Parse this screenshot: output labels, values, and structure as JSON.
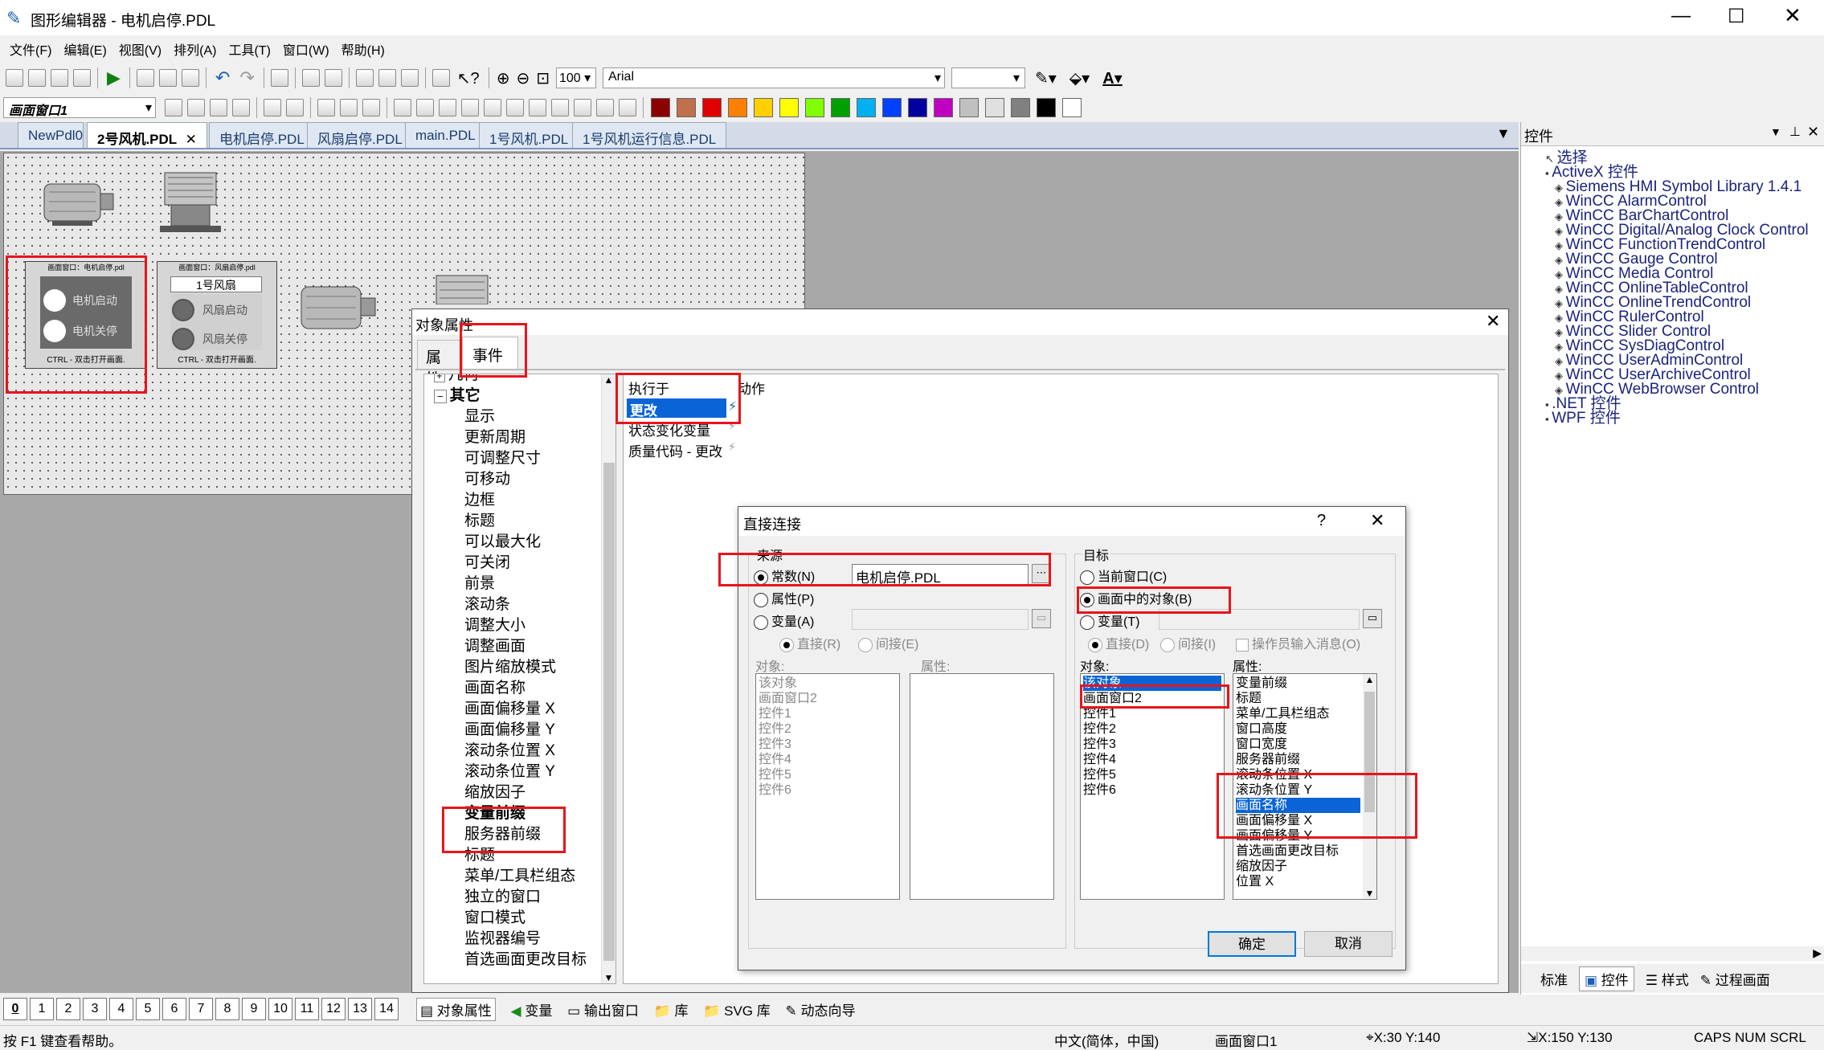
{
  "title_bar": {
    "title": "图形编辑器 - 电机启停.PDL"
  },
  "menu": [
    "文件(F)",
    "编辑(E)",
    "视图(V)",
    "排列(A)",
    "工具(T)",
    "窗口(W)",
    "帮助(H)"
  ],
  "toolbar": {
    "zoom": "100",
    "font": "Arial",
    "screen_window": "画面窗口1"
  },
  "palette_colors": [
    "#8b0000",
    "#c0704a",
    "#e00000",
    "#ff8000",
    "#ffd000",
    "#ffff00",
    "#80ff00",
    "#00a000",
    "#00b0f0",
    "#0040ff",
    "#0000a0",
    "#c000c0",
    "#c0c0c0",
    "#e0e0e0",
    "#808080",
    "#000000",
    "#ffffff"
  ],
  "doc_tabs": [
    "NewPdl0",
    "2号风机.PDL",
    "电机启停.PDL",
    "风扇启停.PDL",
    "main.PDL",
    "1号风机.PDL",
    "1号风机运行信息.PDL"
  ],
  "canvas": {
    "panel1": {
      "header": "画面窗口：电机启停.pdl",
      "start": "电机启动",
      "stop": "电机关停",
      "footer": "CTRL - 双击打开画面."
    },
    "panel2": {
      "header": "画面窗口：风扇启停.pdl",
      "title": "1号风扇",
      "start": "风扇启动",
      "stop": "风扇关停",
      "footer": "CTRL - 双击打开画面."
    }
  },
  "obj_props": {
    "title": "对象属性",
    "tabs": [
      "属性",
      "事件"
    ],
    "tree": {
      "group_collapsed": "几何",
      "group_open": "其它",
      "items": [
        "显示",
        "更新周期",
        "可调整尺寸",
        "可移动",
        "边框",
        "标题",
        "可以最大化",
        "可关闭",
        "前景",
        "滚动条",
        "调整大小",
        "调整画面",
        "图片缩放模式",
        "画面名称",
        "画面偏移量 X",
        "画面偏移量 Y",
        "滚动条位置 X",
        "滚动条位置 Y",
        "缩放因子",
        "变量前缀",
        "服务器前缀",
        "标题",
        "菜单/工具栏组态",
        "独立的窗口",
        "窗口模式",
        "监视器编号",
        "首选画面更改目标"
      ]
    },
    "event_cols": {
      "trigger": "执行于",
      "action": "动作"
    },
    "events": [
      "更改",
      "状态变化变量",
      "质量代码 - 更改"
    ]
  },
  "direct_conn": {
    "title": "直接连接",
    "help": "?",
    "source": {
      "label": "来源",
      "constant": "常数(N)",
      "constant_value": "电机启停.PDL",
      "property": "属性(P)",
      "variable": "变量(A)",
      "direct": "直接(R)",
      "indirect": "间接(E)",
      "obj_label": "对象:",
      "prop_label": "属性:",
      "objects": [
        "该对象",
        "画面窗口2",
        "控件1",
        "控件2",
        "控件3",
        "控件4",
        "控件5",
        "控件6"
      ]
    },
    "target": {
      "label": "目标",
      "current_window": "当前窗口(C)",
      "object_in_screen": "画面中的对象(B)",
      "variable": "变量(T)",
      "direct": "直接(D)",
      "indirect": "间接(I)",
      "operator_msg": "操作员输入消息(O)",
      "obj_label": "对象:",
      "prop_label": "属性:",
      "objects": [
        "该对象",
        "画面窗口2",
        "控件1",
        "控件2",
        "控件3",
        "控件4",
        "控件5",
        "控件6"
      ],
      "properties": [
        "变量前缀",
        "标题",
        "菜单/工具栏组态",
        "窗口高度",
        "窗口宽度",
        "服务器前缀",
        "滚动条位置 X",
        "滚动条位置 Y",
        "画面名称",
        "画面偏移量 X",
        "画面偏移量 Y",
        "首选画面更改目标",
        "缩放因子",
        "位置 X"
      ],
      "selected_property_index": 8
    },
    "ok": "确定",
    "cancel": "取消"
  },
  "controls_panel": {
    "title": "控件",
    "items": [
      {
        "label": "选择",
        "level": 1
      },
      {
        "label": "ActiveX 控件",
        "level": 1
      },
      {
        "label": "Siemens HMI Symbol Library 1.4.1",
        "level": 2
      },
      {
        "label": "WinCC AlarmControl",
        "level": 2
      },
      {
        "label": "WinCC BarChartControl",
        "level": 2
      },
      {
        "label": "WinCC Digital/Analog Clock Control",
        "level": 2
      },
      {
        "label": "WinCC FunctionTrendControl",
        "level": 2
      },
      {
        "label": "WinCC Gauge Control",
        "level": 2
      },
      {
        "label": "WinCC Media Control",
        "level": 2
      },
      {
        "label": "WinCC OnlineTableControl",
        "level": 2
      },
      {
        "label": "WinCC OnlineTrendControl",
        "level": 2
      },
      {
        "label": "WinCC RulerControl",
        "level": 2
      },
      {
        "label": "WinCC Slider Control",
        "level": 2
      },
      {
        "label": "WinCC SysDiagControl",
        "level": 2
      },
      {
        "label": "WinCC UserAdminControl",
        "level": 2
      },
      {
        "label": "WinCC UserArchiveControl",
        "level": 2
      },
      {
        "label": "WinCC WebBrowser Control",
        "level": 2
      },
      {
        "label": ".NET 控件",
        "level": 1
      },
      {
        "label": "WPF 控件",
        "level": 1
      }
    ],
    "bottom_tabs": [
      "标准",
      "控件",
      "样式",
      "过程画面"
    ]
  },
  "layer_buttons": [
    "0",
    "1",
    "2",
    "3",
    "4",
    "5",
    "6",
    "7",
    "8",
    "9",
    "10",
    "11",
    "12",
    "13",
    "14"
  ],
  "bottom_tabs": [
    "对象属性",
    "变量",
    "输出窗口",
    "库",
    "SVG 库",
    "动态向导"
  ],
  "status": {
    "help": "按 F1 键查看帮助。",
    "lang": "中文(简体，中国)",
    "object": "画面窗口1",
    "pos1": "X:30 Y:140",
    "pos2": "X:150 Y:130",
    "keys": "CAPS NUM SCRL"
  }
}
